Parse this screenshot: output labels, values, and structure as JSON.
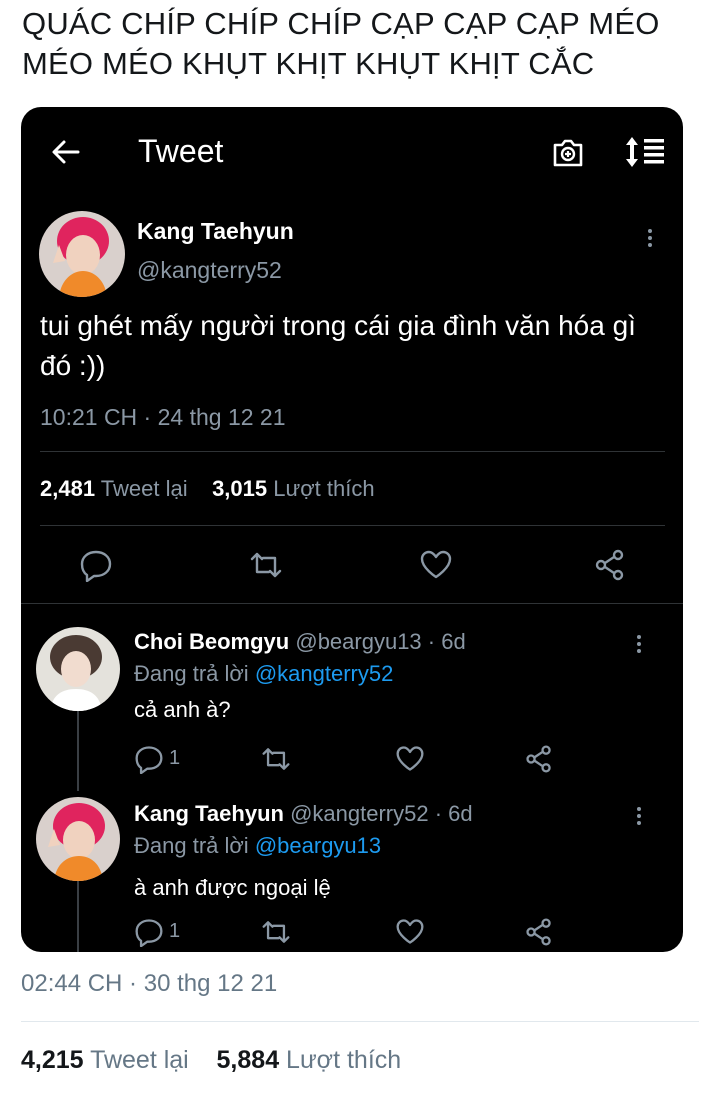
{
  "headline": "QUÁC CHÍP CHÍP CHÍP CẠP CẠP CẠP MÉO MÉO MÉO KHỤT KHỊT KHỤT KHỊT CẮC",
  "screenshot": {
    "topbar": {
      "title": "Tweet",
      "back_icon": "arrow-left-icon",
      "camera_icon": "camera-plus-icon",
      "sort_icon": "sort-lines-icon"
    },
    "tweet": {
      "author_name": "Kang Taehyun",
      "author_handle": "@kangterry52",
      "text": "tui ghét mấy người trong cái gia đình văn hóa gì đó :))",
      "timestamp": "10:21 CH · 24 thg 12 21",
      "retweets_count": "2,481",
      "retweets_label": "Tweet lại",
      "likes_count": "3,015",
      "likes_label": "Lượt thích",
      "actions": [
        "reply-icon",
        "retweet-icon",
        "heart-icon",
        "share-icon"
      ]
    },
    "replies": [
      {
        "name": "Choi Beomgyu",
        "handle_time": "@beargyu13 · 6d",
        "replying_prefix": "Đang trả lời",
        "replying_to": "@kangterry52",
        "text": "cả anh à?",
        "reply_count": "1"
      },
      {
        "name": "Kang Taehyun",
        "handle_time": "@kangterry52 · 6d",
        "replying_prefix": "Đang trả lời",
        "replying_to": "@beargyu13",
        "text": "à anh được ngoại lệ",
        "reply_count": "1"
      }
    ]
  },
  "footer": {
    "timestamp": "02:44 CH · 30 thg 12 21",
    "retweets_count": "4,215",
    "retweets_label": "Tweet lại",
    "likes_count": "5,884",
    "likes_label": "Lượt thích"
  },
  "colors": {
    "accent": "#1d9bf0",
    "dark_bg": "#000000",
    "muted": "#8b98a5"
  }
}
